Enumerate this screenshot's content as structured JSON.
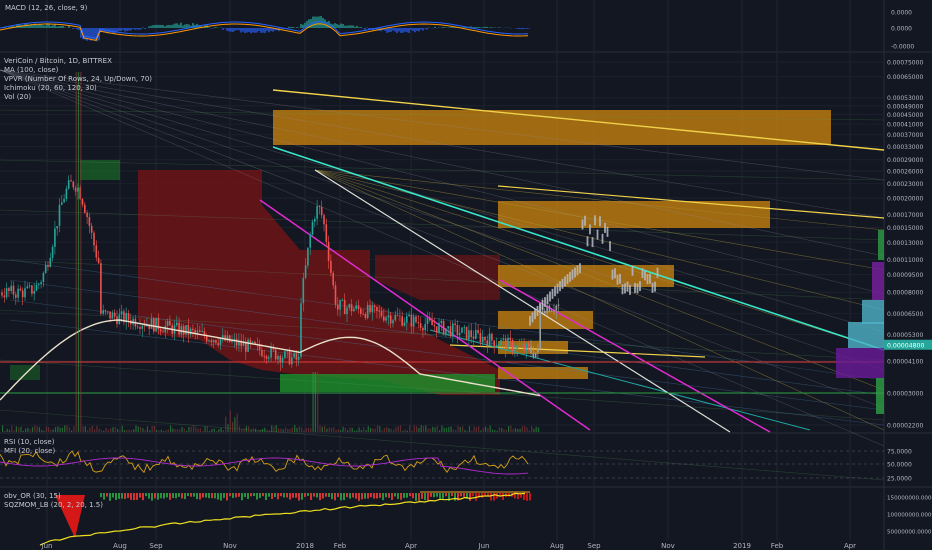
{
  "chart_data": {
    "type": "candlestick",
    "title": "VeriCoin / Bitcoin, 1D, BITTREX",
    "indicators_main": [
      "MA (100, close)",
      "VPVR (Number Of Rows, 24, Up/Down, 70)",
      "Ichimoku (20, 60, 120, 30)",
      "Vol (20)"
    ],
    "macd_label": "MACD (12, 26, close, 9)",
    "macd_ticks": [
      "0.0000",
      "0.0000",
      "-0.0000"
    ],
    "rsi_label": "RSI (10, close)",
    "mfi_label": "MFI (20, close)",
    "rsi_ticks": [
      "75.0000",
      "50.0000",
      "25.0000"
    ],
    "obv_label": "obv_OR (30, 15)",
    "sqz_label": "SQZMOM_LB (20, 2, 20, 1.5)",
    "obv_ticks": [
      "150000000.0000",
      "100000000.0000",
      "50000000.0000"
    ],
    "price_ticks": [
      "0.00075000",
      "0.00065000",
      "0.00053000",
      "0.00049000",
      "0.00045000",
      "0.00041000",
      "0.00037000",
      "0.00033000",
      "0.00029000",
      "0.00026000",
      "0.00023000",
      "0.00020000",
      "0.00017000",
      "0.00015000",
      "0.00013000",
      "0.00011000",
      "0.00009500",
      "0.00008000",
      "0.00006500",
      "0.00005300",
      "0.00004100",
      "0.00003000",
      "0.00002200"
    ],
    "last_price": "0.00004800",
    "x_tick_labels": [
      "Jun",
      "Aug",
      "Sep",
      "Nov",
      "2018",
      "Feb",
      "Apr",
      "Jun",
      "Aug",
      "Sep",
      "Nov",
      "2019",
      "Feb",
      "Apr"
    ],
    "colors": {
      "background": "#131722",
      "grid": "#1f2431",
      "up": "#26a69a",
      "down": "#ef5350",
      "ma": "#e8e0c8",
      "yellow_line": "#f0d24a",
      "cyan_line": "#39e6c8",
      "magenta_line": "#e02bd0",
      "orange_box": "#c4800f",
      "red_cloud": "#7a1414",
      "green_cloud": "#1e8a2a",
      "price_label_bg": "#26a69a"
    }
  }
}
